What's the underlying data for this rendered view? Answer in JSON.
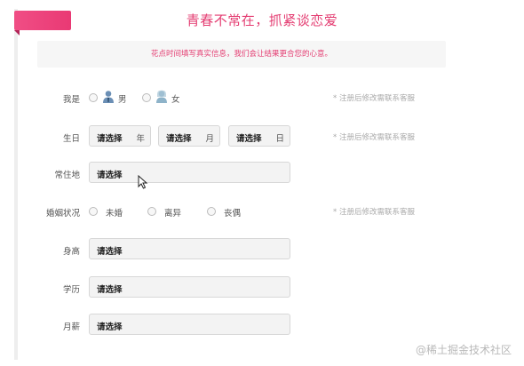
{
  "header": {
    "title": "青春不常在，抓紧谈恋爱",
    "notice": "花点时间填写真实信息，我们会让结果更合您的心意。"
  },
  "form": {
    "gender": {
      "label": "我是",
      "options": [
        "男",
        "女"
      ],
      "note": "* 注册后修改需联系客服"
    },
    "birthday": {
      "label": "生日",
      "year": {
        "value": "请选择",
        "unit": "年"
      },
      "month": {
        "value": "请选择",
        "unit": "月"
      },
      "day": {
        "value": "请选择",
        "unit": "日"
      },
      "note": "* 注册后修改需联系客服"
    },
    "residence": {
      "label": "常住地",
      "value": "请选择"
    },
    "marital": {
      "label": "婚姻状况",
      "options": [
        "未婚",
        "离异",
        "丧偶"
      ],
      "note": "* 注册后修改需联系客服"
    },
    "height": {
      "label": "身高",
      "value": "请选择"
    },
    "education": {
      "label": "学历",
      "value": "请选择"
    },
    "salary": {
      "label": "月薪",
      "value": "请选择"
    }
  },
  "watermark": "@稀土掘金技术社区",
  "colors": {
    "accent": "#e43d72",
    "ribbon": "#f04e85",
    "note": "#aaaaaa"
  },
  "icons": {
    "male": "male-user-icon",
    "female": "female-user-icon",
    "cursor": "mouse-cursor-icon"
  }
}
